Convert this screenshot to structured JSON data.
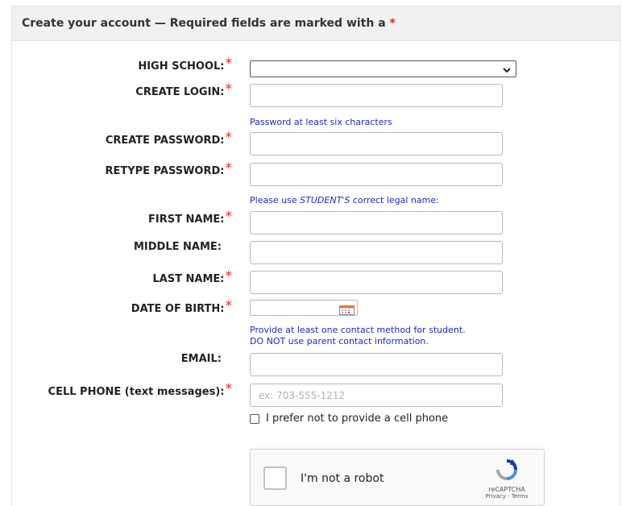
{
  "header": {
    "title": "Create your account — Required fields are marked with a",
    "required_marker": "*"
  },
  "form": {
    "high_school": {
      "label": "HIGH SCHOOL:",
      "value": ""
    },
    "create_login": {
      "label": "CREATE LOGIN:",
      "value": ""
    },
    "password_hint": "Password at least six characters",
    "create_password": {
      "label": "CREATE PASSWORD:",
      "value": ""
    },
    "retype_password": {
      "label": "RETYPE PASSWORD:",
      "value": ""
    },
    "name_hint": {
      "before": "Please use ",
      "emph": "STUDENT'S",
      "after": " correct legal name:"
    },
    "first_name": {
      "label": "FIRST NAME:",
      "value": ""
    },
    "middle_name": {
      "label": "MIDDLE NAME:",
      "value": ""
    },
    "last_name": {
      "label": "LAST NAME:",
      "value": ""
    },
    "date_of_birth": {
      "label": "DATE OF BIRTH:",
      "value": ""
    },
    "contact_hint_1": "Provide at least one contact method for student.",
    "contact_hint_2": "DO NOT use parent contact information.",
    "email": {
      "label": "EMAIL:",
      "value": ""
    },
    "cell_phone": {
      "label": "CELL PHONE (text messages):",
      "placeholder": "ex: 703-555-1212",
      "value": ""
    },
    "no_cell_checkbox": {
      "label": "I prefer not to provide a cell phone",
      "checked": false
    }
  },
  "captcha": {
    "label": "I'm not a robot",
    "brand": "reCAPTCHA",
    "links": "Privacy - Terms"
  },
  "colors": {
    "required": "#e8251b",
    "hint": "#1a2bc4",
    "header_bg": "#f1f1f1"
  }
}
